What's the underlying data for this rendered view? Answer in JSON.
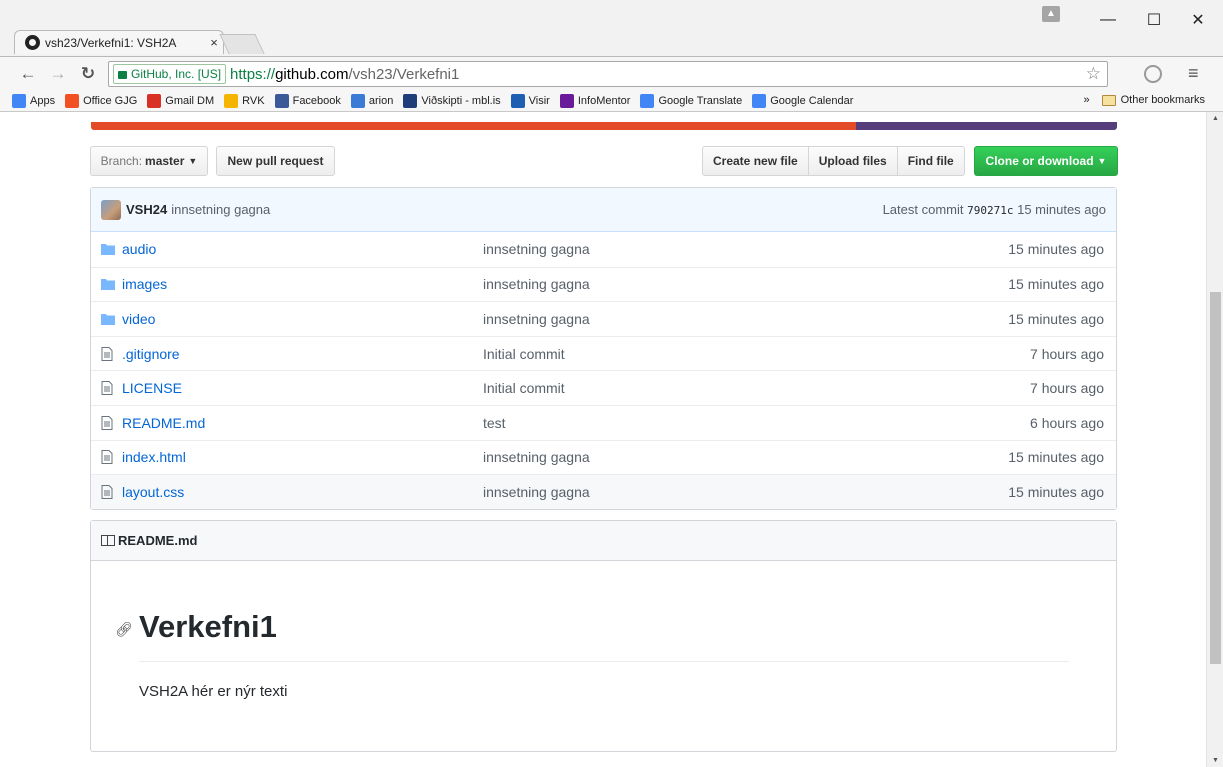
{
  "browser": {
    "tab_title": "vsh23/Verkefni1: VSH2A",
    "tab_close": "×",
    "ev_label": "GitHub, Inc. [US]",
    "url_scheme": "https://",
    "url_host": "github.com",
    "url_path": "/vsh23/Verkefni1",
    "win_minimize": "—",
    "win_maximize": "☐",
    "win_close": "✕"
  },
  "bookmarks": {
    "items": [
      {
        "label": "Apps",
        "color": "#4285f4"
      },
      {
        "label": "Office GJG",
        "color": "#f25022"
      },
      {
        "label": "Gmail DM",
        "color": "#d93025"
      },
      {
        "label": "RVK",
        "color": "#f4b400"
      },
      {
        "label": "Facebook",
        "color": "#3b5998"
      },
      {
        "label": "arion",
        "color": "#3a7bd5"
      },
      {
        "label": "Viðskipti - mbl.is",
        "color": "#1f3d7a"
      },
      {
        "label": "Visir",
        "color": "#1d5fb0"
      },
      {
        "label": "InfoMentor",
        "color": "#6a1b9a"
      },
      {
        "label": "Google Translate",
        "color": "#4285f4"
      },
      {
        "label": "Google Calendar",
        "color": "#4285f4"
      }
    ],
    "overflow": "»",
    "other": "Other bookmarks"
  },
  "repo": {
    "branch_prefix": "Branch:",
    "branch_name": "master",
    "new_pr": "New pull request",
    "create_file": "Create new file",
    "upload_files": "Upload files",
    "find_file": "Find file",
    "clone": "Clone or download",
    "lang_colors": {
      "html": "#e34c26",
      "css": "#563d7c"
    }
  },
  "commit": {
    "author": "VSH24",
    "message": "innsetning gagna",
    "latest_label": "Latest commit",
    "sha": "790271c",
    "age": "15 minutes ago"
  },
  "files": [
    {
      "type": "dir",
      "name": "audio",
      "message": "innsetning gagna",
      "age": "15 minutes ago"
    },
    {
      "type": "dir",
      "name": "images",
      "message": "innsetning gagna",
      "age": "15 minutes ago"
    },
    {
      "type": "dir",
      "name": "video",
      "message": "innsetning gagna",
      "age": "15 minutes ago"
    },
    {
      "type": "file",
      "name": ".gitignore",
      "message": "Initial commit",
      "age": "7 hours ago"
    },
    {
      "type": "file",
      "name": "LICENSE",
      "message": "Initial commit",
      "age": "7 hours ago"
    },
    {
      "type": "file",
      "name": "README.md",
      "message": "test",
      "age": "6 hours ago"
    },
    {
      "type": "file",
      "name": "index.html",
      "message": "innsetning gagna",
      "age": "15 minutes ago"
    },
    {
      "type": "file",
      "name": "layout.css",
      "message": "innsetning gagna",
      "age": "15 minutes ago"
    }
  ],
  "readme": {
    "header": "README.md",
    "heading": "Verkefni1",
    "body": "VSH2A hér er nýr texti"
  }
}
